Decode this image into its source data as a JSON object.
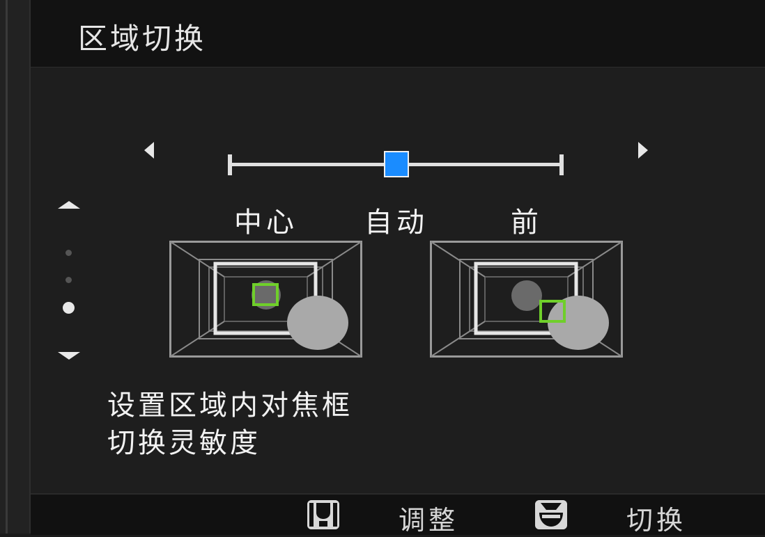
{
  "header": {
    "title": "区域切换"
  },
  "slider": {
    "options": [
      "中心",
      "自动",
      "前"
    ],
    "selected": "自动",
    "value": 0.5,
    "thumb_color": "#1a8cff"
  },
  "labels": {
    "center": "中心",
    "auto": "自动",
    "front": "前"
  },
  "vertical_nav": {
    "page_count": 3,
    "current_page": 3
  },
  "illustrations": [
    {
      "name": "center-illustration",
      "focus_frame_color": "#6fcf2a"
    },
    {
      "name": "front-illustration",
      "focus_frame_color": "#6fcf2a"
    }
  ],
  "description": {
    "line1": "设置区域内对焦框",
    "line2": "切换灵敏度"
  },
  "footer": {
    "adjust_label": "调整",
    "switch_label": "切换",
    "adjust_icon": "left-right-dial-icon",
    "switch_icon": "up-down-dial-icon"
  }
}
